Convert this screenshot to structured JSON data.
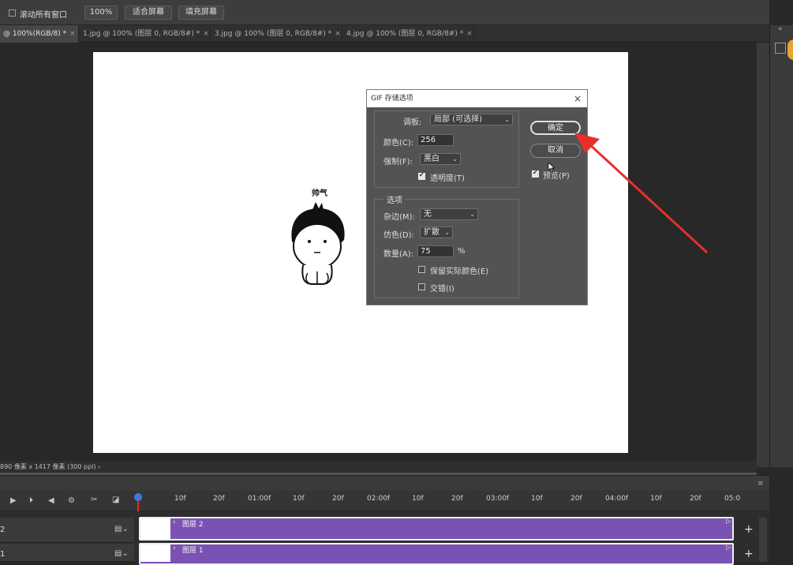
{
  "options_bar": {
    "scroll_all_windows_label": "滚动所有窗口",
    "zoom_100_label": "100%",
    "fit_screen_label": "适合屏幕",
    "fill_screen_label": "填充屏幕"
  },
  "tabs": [
    {
      "label": "@ 100%(RGB/8) *",
      "close": "×"
    },
    {
      "label": "1.jpg @ 100% (图层 0, RGB/8#) *",
      "close": "×"
    },
    {
      "label": "3.jpg @ 100% (图层 0, RGB/8#) *",
      "close": "×"
    },
    {
      "label": "4.jpg @ 100% (图层 0, RGB/8#) *",
      "close": "×"
    }
  ],
  "canvas": {
    "character_caption": "帅气"
  },
  "status": {
    "doc_size": "890 像素 x 1417 像素 (300 ppi)",
    "chevron": "›"
  },
  "dialog": {
    "title": "GIF 存储选项",
    "palette_label": "调板:",
    "palette_value": "局部 (可选择)",
    "colors_label": "颜色(C):",
    "colors_value": "256",
    "forced_label": "强制(F):",
    "forced_value": "黑白",
    "transparency_label": "透明度(T)",
    "options_group_label": "选项",
    "matte_label": "杂边(M):",
    "matte_value": "无",
    "dither_label": "仿色(D):",
    "dither_value": "扩散",
    "amount_label": "数量(A):",
    "amount_value": "75",
    "percent": "%",
    "preserve_colors_label": "保留实际颜色(E)",
    "interlaced_label": "交错(I)",
    "ok_label": "确定",
    "cancel_label": "取消",
    "preview_label": "预览(P)",
    "transparency_checked": true,
    "preview_checked": true,
    "preserve_checked": false,
    "interlaced_checked": false
  },
  "timeline": {
    "ruler": [
      "10f",
      "20f",
      "01:00f",
      "10f",
      "20f",
      "02:00f",
      "10f",
      "20f",
      "03:00f",
      "10f",
      "20f",
      "04:00f",
      "10f",
      "20f",
      "05:0"
    ],
    "tracks": [
      {
        "number": "2",
        "name": "图层 2"
      },
      {
        "number": "1",
        "name": "图层 1"
      }
    ],
    "add_label": "+"
  },
  "colors": {
    "clip_purple": "#7a52b3",
    "arrow_red": "#e8302b",
    "playhead_blue": "#3a7be0"
  }
}
